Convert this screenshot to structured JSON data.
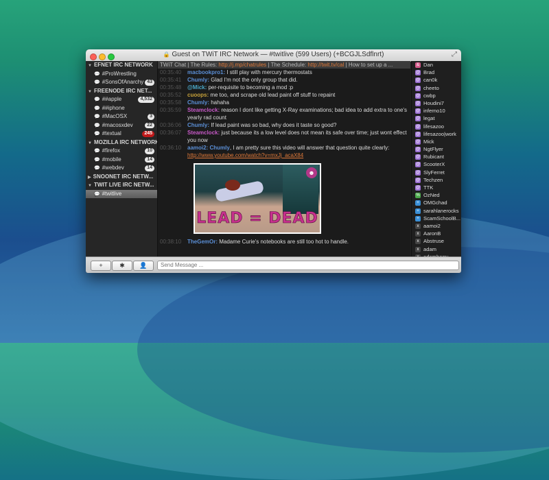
{
  "window": {
    "title": "Guest on TWiT IRC Network — #twitlive (599 Users) (+BCGJLSdflnrt)"
  },
  "networks": [
    {
      "name": "EFNET IRC NETWORK",
      "channels": [
        {
          "name": "#ProWrestling",
          "badge": ""
        },
        {
          "name": "#SonsOfAnarchy",
          "badge": "43"
        }
      ]
    },
    {
      "name": "FREENODE IRC NET...",
      "channels": [
        {
          "name": "##apple",
          "badge": "4,532"
        },
        {
          "name": "##iphone",
          "badge": ""
        },
        {
          "name": "#MacOSX",
          "badge": "3"
        },
        {
          "name": "#macosxdev",
          "badge": "22"
        },
        {
          "name": "#textual",
          "badge": "245"
        }
      ]
    },
    {
      "name": "MOZILLA IRC NETWORK",
      "channels": [
        {
          "name": "#firefox",
          "badge": "10"
        },
        {
          "name": "#mobile",
          "badge": "14"
        },
        {
          "name": "#webdev",
          "badge": "14"
        }
      ]
    },
    {
      "name": "SNOONET IRC NETW...",
      "channels": []
    },
    {
      "name": "TWIT LIVE IRC NETW...",
      "channels": [
        {
          "name": "#twitlive",
          "badge": ""
        }
      ]
    }
  ],
  "topic": {
    "prefix": "TWiT Chat | The Rules: ",
    "link1": "http://j.mp/chatrules",
    "mid": " | The Schedule: ",
    "link2": "http://twit.tv/cal",
    "suffix": " | How to set up a ..."
  },
  "messages": [
    {
      "time": "00:35:40",
      "nick": "macbookpro1:",
      "text": " I still play with mercury thermostats",
      "nick_color": "#5b8fd6"
    },
    {
      "time": "00:35:41",
      "nick": "Chumly:",
      "text": " Glad I'm not the only group that did.",
      "nick_color": "#5b8fd6"
    },
    {
      "time": "00:35:48",
      "nick": "@Mick:",
      "text": " per-requisite to becoming a mod :p",
      "nick_color": "#4aa8c8"
    },
    {
      "time": "00:35:52",
      "nick": "cuoops:",
      "text": " me too, and scrape old lead paint off stuff to repaint",
      "nick_color": "#c8a23a"
    },
    {
      "time": "00:35:58",
      "nick": "Chumly:",
      "text": " hahaha",
      "nick_color": "#5b8fd6"
    },
    {
      "time": "00:35:59",
      "nick": "Steamclock:",
      "text": " reason I dont like getting X-Ray examinations; bad idea to add extra to one's yearly rad count",
      "nick_color": "#c85ac8"
    },
    {
      "time": "00:36:06",
      "nick": "Chumly:",
      "text": " If lead paint was so bad, why does it taste so good?",
      "nick_color": "#5b8fd6"
    },
    {
      "time": "00:36:07",
      "nick": "Steamclock:",
      "text": " just because its a low level does not mean its safe over time; just wont effect you now",
      "nick_color": "#c85ac8"
    },
    {
      "time": "00:36:10",
      "nick": "aamoi2:",
      "nick2": "Chumly",
      "text": ", I am pretty sure this video will answer that question quite clearly:",
      "link": "http://www.youtube.com/watch?v=mxJj_acaX84",
      "nick_color": "#5b8fd6"
    }
  ],
  "image_caption": "LEAD = DEAD",
  "last_message": {
    "time": "00:38:10",
    "nick": "TheGemOr:",
    "text": " Madame Curie's notebooks are still too hot to handle.",
    "nick_color": "#5b8fd6"
  },
  "users": [
    {
      "mode": "&",
      "name": "Dan",
      "color": "#d45a8a"
    },
    {
      "mode": "@",
      "name": "Brad",
      "color": "#9b6fd4"
    },
    {
      "mode": "@",
      "name": "can0k",
      "color": "#9b6fd4"
    },
    {
      "mode": "@",
      "name": "cheeto",
      "color": "#9b6fd4"
    },
    {
      "mode": "@",
      "name": "cwbp",
      "color": "#9b6fd4"
    },
    {
      "mode": "@",
      "name": "Houdini7",
      "color": "#9b6fd4"
    },
    {
      "mode": "@",
      "name": "inferno10",
      "color": "#9b6fd4"
    },
    {
      "mode": "@",
      "name": "legat",
      "color": "#9b6fd4"
    },
    {
      "mode": "@",
      "name": "lifesazoo",
      "color": "#9b6fd4"
    },
    {
      "mode": "@",
      "name": "lifesazoo|work",
      "color": "#9b6fd4"
    },
    {
      "mode": "@",
      "name": "Mick",
      "color": "#9b6fd4"
    },
    {
      "mode": "@",
      "name": "NgtFlyer",
      "color": "#9b6fd4"
    },
    {
      "mode": "@",
      "name": "Rubicant",
      "color": "#9b6fd4"
    },
    {
      "mode": "@",
      "name": "ScooterX",
      "color": "#9b6fd4"
    },
    {
      "mode": "@",
      "name": "SlyFerret",
      "color": "#9b6fd4"
    },
    {
      "mode": "@",
      "name": "Techzen",
      "color": "#9b6fd4"
    },
    {
      "mode": "@",
      "name": "TTK",
      "color": "#9b6fd4"
    },
    {
      "mode": "%",
      "name": "OzNed",
      "color": "#4aa84a"
    },
    {
      "mode": "+",
      "name": "OMGchad",
      "color": "#3a8fd6"
    },
    {
      "mode": "+",
      "name": "sarahlanerocks",
      "color": "#3a8fd6"
    },
    {
      "mode": "+",
      "name": "ScamSchoolB...",
      "color": "#3a8fd6"
    },
    {
      "mode": "x",
      "name": "aamoi2",
      "color": "#444444"
    },
    {
      "mode": "x",
      "name": "AaronB",
      "color": "#444444"
    },
    {
      "mode": "x",
      "name": "Abstruse",
      "color": "#444444"
    },
    {
      "mode": "x",
      "name": "adam",
      "color": "#444444"
    },
    {
      "mode": "x",
      "name": "adamberry",
      "color": "#444444"
    }
  ],
  "input": {
    "placeholder": "Send Message ..."
  },
  "buttons": {
    "add": "+",
    "settings": "✱",
    "user": "👤"
  }
}
